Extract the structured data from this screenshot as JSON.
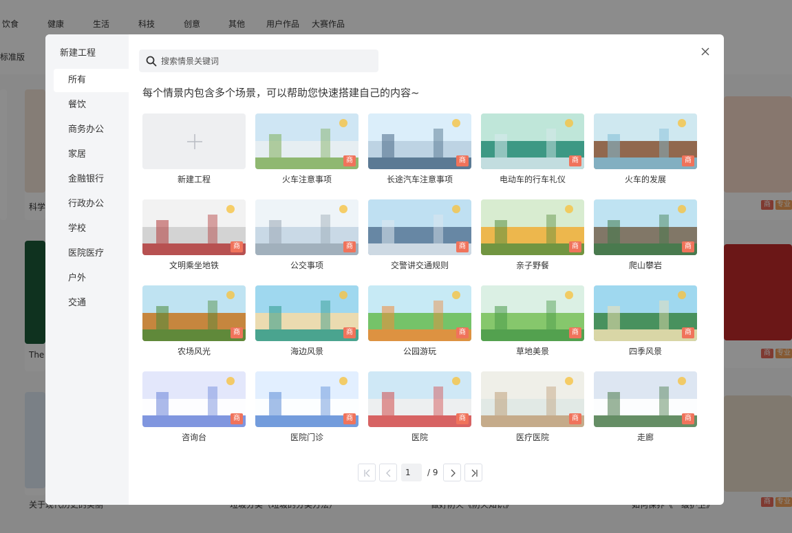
{
  "background": {
    "nav_items": [
      "饮食",
      "健康",
      "生活",
      "科技",
      "创意",
      "其他",
      "用户作品",
      "大赛作品"
    ],
    "sub_label": "标准版",
    "captions": [
      "科学",
      "The",
      "关于现代历史的美丽",
      "垃圾分类（垃圾的分类方法）",
      "做好防火《防火知识》",
      "如何保养《一级护卫》"
    ],
    "tag_shang": "商",
    "tag_pro": "专业"
  },
  "modal": {
    "sidebar_title": "新建工程",
    "categories": [
      "所有",
      "餐饮",
      "商务办公",
      "家居",
      "金融银行",
      "行政办公",
      "学校",
      "医院医疗",
      "户外",
      "交通"
    ],
    "active_category": "所有",
    "search_placeholder": "搜索情景关键词",
    "subtitle": "每个情景内包含多个场景，可以帮助您快速搭建自己的内容~",
    "new_project_label": "新建工程",
    "badge": "商",
    "templates": [
      {
        "label": "火车注意事项",
        "palette": [
          "#cfe6f4",
          "#e8eef2",
          "#7fae5a"
        ]
      },
      {
        "label": "长途汽车注意事项",
        "palette": [
          "#dbeefa",
          "#b9cfe0",
          "#4a6a86"
        ]
      },
      {
        "label": "电动车的行车礼仪",
        "palette": [
          "#bfe6d9",
          "#2f8f7a",
          "#d9e9ee"
        ]
      },
      {
        "label": "火车的发展",
        "palette": [
          "#cfe8f0",
          "#8a5a3c",
          "#7fbcd6"
        ]
      },
      {
        "label": "文明乘坐地铁",
        "palette": [
          "#f2f2f2",
          "#cfcfcf",
          "#b23a3a"
        ]
      },
      {
        "label": "公交事项",
        "palette": [
          "#eef4f8",
          "#c4d6e3",
          "#9aa8b4"
        ]
      },
      {
        "label": "交警讲交通规则",
        "palette": [
          "#bfe0f2",
          "#5d7d9b",
          "#dfe7ee"
        ]
      },
      {
        "label": "亲子野餐",
        "palette": [
          "#d8ecd0",
          "#f0b13e",
          "#5a8f3f"
        ]
      },
      {
        "label": "爬山攀岩",
        "palette": [
          "#bfe3f2",
          "#7a6a58",
          "#3f7a4a"
        ]
      },
      {
        "label": "农场风光",
        "palette": [
          "#bfe3f2",
          "#c77b2a",
          "#4d8a3a"
        ]
      },
      {
        "label": "海边风景",
        "palette": [
          "#9fd8ef",
          "#f3dca8",
          "#2e9a8a"
        ]
      },
      {
        "label": "公园游玩",
        "palette": [
          "#c7eaf5",
          "#6cbf5a",
          "#f08a3b"
        ]
      },
      {
        "label": "草地美景",
        "palette": [
          "#dbf0e4",
          "#7cc25e",
          "#4a9a4a"
        ]
      },
      {
        "label": "四季风景",
        "palette": [
          "#9fd8ef",
          "#3e8a4e",
          "#f3e2b3"
        ]
      },
      {
        "label": "咨询台",
        "palette": [
          "#e3e7fb",
          "#ffffff",
          "#6a84d9"
        ]
      },
      {
        "label": "医院门诊",
        "palette": [
          "#e2efff",
          "#ffffff",
          "#5b8bd6"
        ]
      },
      {
        "label": "医院",
        "palette": [
          "#cfe8f6",
          "#f0f0f0",
          "#d24a4a"
        ]
      },
      {
        "label": "医疗医院",
        "palette": [
          "#efefe8",
          "#dfe8e4",
          "#c0a07a"
        ]
      },
      {
        "label": "走廊",
        "palette": [
          "#dde6f2",
          "#ffffff",
          "#4a7a4a"
        ]
      }
    ],
    "pagination": {
      "current": "1",
      "total": "/ 9"
    }
  }
}
